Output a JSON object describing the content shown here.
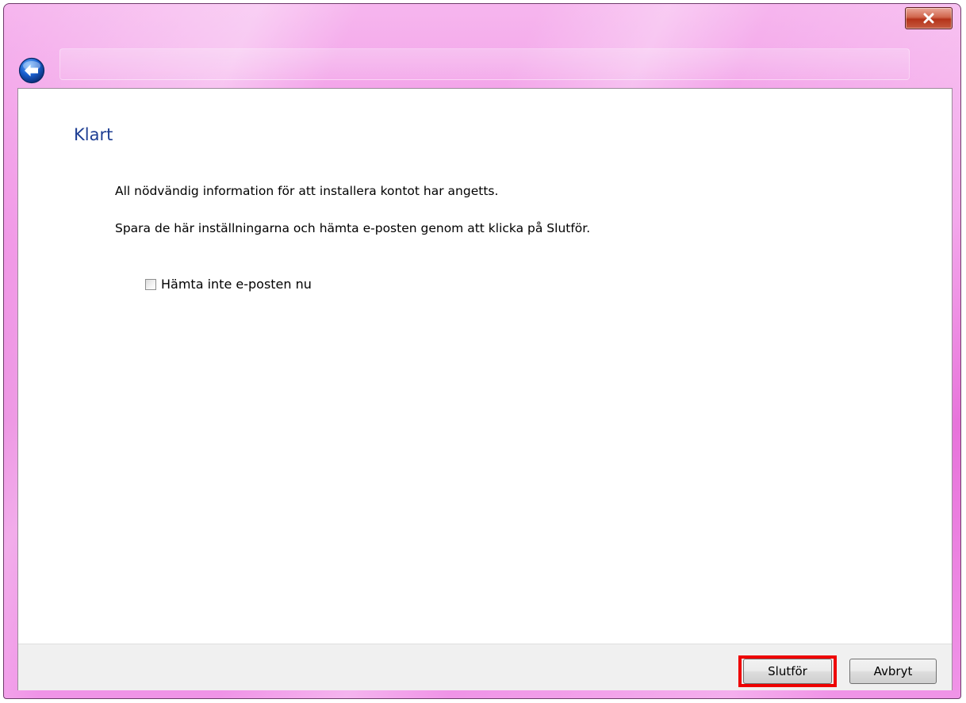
{
  "window": {
    "frame_color": "#ee86e2",
    "icons": {
      "close": "close-icon",
      "back": "back-arrow-icon"
    }
  },
  "page": {
    "title": "Klart",
    "line1": "All nödvändig information för att installera kontot har angetts.",
    "line2": "Spara de här inställningarna och hämta e-posten genom att klicka på Slutför."
  },
  "options": {
    "dont_fetch_label": "Hämta inte e-posten nu",
    "dont_fetch_checked": false
  },
  "footer": {
    "finish_label": "Slutför",
    "cancel_label": "Avbryt",
    "highlight_color": "#ee0000"
  }
}
